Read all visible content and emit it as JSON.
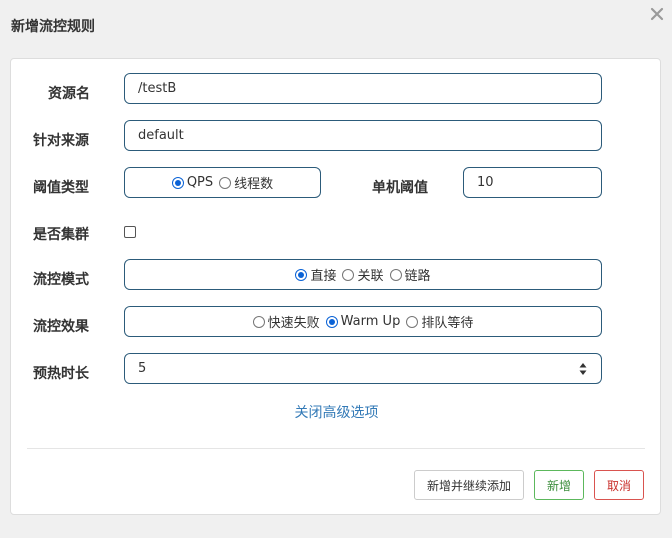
{
  "dialog": {
    "title": "新增流控规则"
  },
  "form": {
    "resource": {
      "label": "资源名",
      "value": "/testB"
    },
    "limit_app": {
      "label": "针对来源",
      "value": "default"
    },
    "grade": {
      "label": "阈值类型",
      "options": [
        {
          "label": "QPS",
          "checked": true
        },
        {
          "label": "线程数",
          "checked": false
        }
      ]
    },
    "threshold": {
      "label": "单机阈值",
      "value": "10"
    },
    "cluster": {
      "label": "是否集群",
      "checked": false
    },
    "strategy": {
      "label": "流控模式",
      "options": [
        {
          "label": "直接",
          "checked": true
        },
        {
          "label": "关联",
          "checked": false
        },
        {
          "label": "链路",
          "checked": false
        }
      ]
    },
    "control_behavior": {
      "label": "流控效果",
      "options": [
        {
          "label": "快速失败",
          "checked": false
        },
        {
          "label": "Warm Up",
          "checked": true
        },
        {
          "label": "排队等待",
          "checked": false
        }
      ]
    },
    "warmup": {
      "label": "预热时长",
      "value": "5"
    },
    "toggle_advanced": "关闭高级选项"
  },
  "footer": {
    "add_continue": "新增并继续添加",
    "add": "新增",
    "cancel": "取消"
  },
  "colors": {
    "field_border": "#2c5b7a",
    "link": "#337ab7",
    "success": "#5cb85c",
    "danger": "#d9534f",
    "radio_checked": "#0a62d6"
  }
}
